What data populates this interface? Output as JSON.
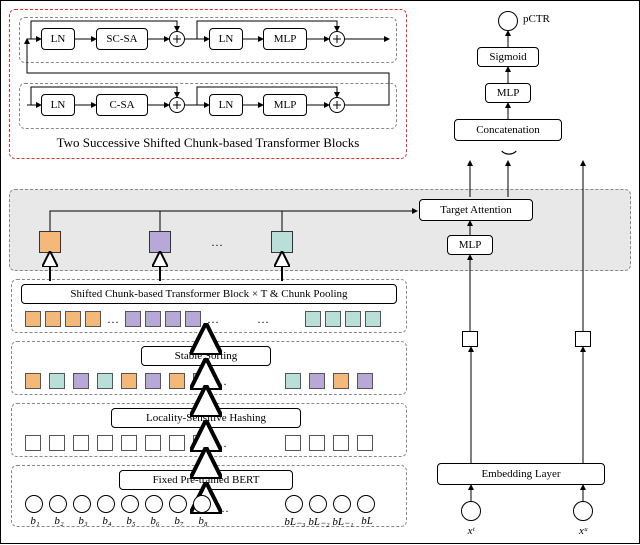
{
  "red_caption": "Two Successive Shifted Chunk-based Transformer Blocks",
  "tblock1": {
    "ln1": "LN",
    "op": "SC-SA",
    "ln2": "LN",
    "mlp": "MLP"
  },
  "tblock2": {
    "ln1": "LN",
    "op": "C-SA",
    "ln2": "LN",
    "mlp": "MLP"
  },
  "right": {
    "pctr": "pCTR",
    "sigmoid": "Sigmoid",
    "mlp": "MLP",
    "concat": "Concatenation",
    "target_attn": "Target Attention",
    "mlp2": "MLP",
    "embed": "Embedding Layer",
    "xt": "xᵗ",
    "xu": "xᵘ"
  },
  "left_stack": {
    "scblock": "Shifted Chunk-based Transformer Block × T & Chunk Pooling",
    "sort": "Stable Sorting",
    "lsh": "Locality-Sensitive Hashing",
    "bert": "Fixed Pre-trained BERT"
  },
  "b_labels": [
    "b₁",
    "b₂",
    "b₃",
    "b₄",
    "b₅",
    "b₆",
    "b₇",
    "b₈",
    "…",
    "bL₋₃",
    "bL₋₂",
    "bL₋₁",
    "bL"
  ],
  "ellipsis": "…"
}
